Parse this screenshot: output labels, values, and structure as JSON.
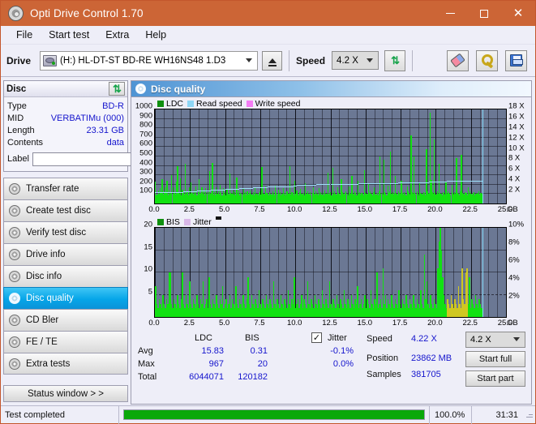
{
  "window": {
    "title": "Opti Drive Control 1.70",
    "icon": "disc-icon",
    "minimize": "—",
    "maximize": "□",
    "close": "✕"
  },
  "menu": {
    "items": [
      "File",
      "Start test",
      "Extra",
      "Help"
    ]
  },
  "toolbar": {
    "drive_label": "Drive",
    "drive_value": "(H:)   HL-DT-ST BD-RE  WH16NS48 1.D3",
    "eject_title": "eject-button",
    "speed_label": "Speed",
    "speed_value": "4.2 X",
    "refresh_icon": "refresh-icon",
    "erase_icon": "eraser-icon",
    "tools_icon": "wrench-icon",
    "save_icon": "floppy-save-icon"
  },
  "disc_panel": {
    "title": "Disc",
    "refresh_icon": "refresh-icon",
    "rows": [
      {
        "key": "Type",
        "value": "BD-R"
      },
      {
        "key": "MID",
        "value": "VERBATIMu (000)"
      },
      {
        "key": "Length",
        "value": "23.31 GB"
      },
      {
        "key": "Contents",
        "value": "data"
      }
    ],
    "label_key": "Label",
    "label_value": "",
    "label_placeholder": "",
    "disc_icon": "cd-disc-icon"
  },
  "nav": {
    "items": [
      {
        "label": "Transfer rate",
        "active": false
      },
      {
        "label": "Create test disc",
        "active": false
      },
      {
        "label": "Verify test disc",
        "active": false
      },
      {
        "label": "Drive info",
        "active": false
      },
      {
        "label": "Disc info",
        "active": false
      },
      {
        "label": "Disc quality",
        "active": true
      },
      {
        "label": "CD Bler",
        "active": false
      },
      {
        "label": "FE / TE",
        "active": false
      },
      {
        "label": "Extra tests",
        "active": false
      }
    ],
    "status_window": "Status window > >"
  },
  "content": {
    "header_title": "Disc quality",
    "header_icon": "disc-quality-icon"
  },
  "stats": {
    "col_ldc": "LDC",
    "col_bis": "BIS",
    "jitter_label": "Jitter",
    "jitter_checked": true,
    "rows": [
      {
        "name": "Avg",
        "ldc": "15.83",
        "bis": "0.31",
        "jitter": "-0.1%"
      },
      {
        "name": "Max",
        "ldc": "967",
        "bis": "20",
        "jitter": "0.0%"
      },
      {
        "name": "Total",
        "ldc": "6044071",
        "bis": "120182",
        "jitter": ""
      }
    ],
    "speed_label": "Speed",
    "speed_value": "4.22 X",
    "position_label": "Position",
    "position_value": "23862 MB",
    "samples_label": "Samples",
    "samples_value": "381705",
    "speed_select": "4.2 X",
    "start_full": "Start full",
    "start_part": "Start part"
  },
  "statusbar": {
    "text": "Test completed",
    "percent": "100.0%",
    "progress": 100,
    "time": "31:31"
  },
  "chart_data": [
    {
      "type": "bar",
      "name": "ldc-chart",
      "title": "LDC",
      "legend": [
        {
          "label": "LDC",
          "color": "#0f8f0f"
        },
        {
          "label": "Read speed",
          "color": "#8ed6f5"
        },
        {
          "label": "Write speed",
          "color": "#f47cf4"
        }
      ],
      "xlabel": "GB",
      "ylabel": "LDC",
      "xlim": [
        0,
        25
      ],
      "ylim": [
        0,
        1000
      ],
      "y2lim": [
        0,
        18
      ],
      "y2label": "X",
      "yticks": [
        100,
        200,
        300,
        400,
        500,
        600,
        700,
        800,
        900,
        1000
      ],
      "y2ticks": [
        2,
        4,
        6,
        8,
        10,
        12,
        14,
        16,
        18
      ],
      "xticks": [
        "0.0",
        "2.5",
        "5.0",
        "7.5",
        "10.0",
        "12.5",
        "15.0",
        "17.5",
        "20.0",
        "22.5",
        "25.0"
      ],
      "data_end_gb": 23.31,
      "bar_color": "#12e112",
      "speed_color": "#9fe0fb",
      "plot_bg": "#6b7894",
      "grid": true,
      "values": [
        230,
        85,
        95,
        140,
        105,
        160,
        120,
        260,
        95,
        130,
        175,
        110,
        240,
        90,
        150,
        105,
        125,
        305,
        100,
        170,
        115,
        95,
        230,
        400,
        120,
        100,
        265,
        90,
        150,
        110,
        95,
        420,
        105,
        130,
        90,
        170,
        100,
        220,
        115,
        95,
        140,
        100,
        185,
        90,
        120,
        255,
        95,
        110,
        170,
        100,
        135,
        90,
        160,
        105,
        120,
        95,
        345,
        100,
        110,
        430,
        95,
        120,
        90,
        170,
        100,
        130,
        95,
        200,
        110,
        90,
        160,
        100,
        125,
        90,
        150,
        105,
        95,
        320,
        110,
        100,
        140,
        95,
        120,
        90,
        280,
        105,
        135,
        90,
        110,
        100,
        95,
        160,
        105,
        120,
        90,
        130,
        95,
        110,
        140,
        100,
        95,
        120,
        90,
        160,
        105,
        100,
        90,
        110,
        130,
        95,
        385,
        105,
        100,
        95,
        185,
        110,
        100,
        90,
        120,
        105,
        95,
        130,
        100,
        90,
        190,
        110,
        95,
        150,
        105,
        120,
        90,
        100,
        165,
        95,
        110,
        90,
        130,
        105,
        100,
        400,
        95,
        120,
        110,
        90,
        245,
        100,
        135,
        105,
        90,
        120,
        155,
        100,
        95,
        110,
        90,
        215,
        105,
        130,
        100,
        95,
        120,
        90,
        110,
        175,
        100,
        95,
        130,
        105,
        90,
        160,
        100,
        120,
        95,
        110,
        90,
        140,
        105,
        100,
        330,
        95,
        110,
        120,
        90,
        380,
        100,
        130,
        105,
        95,
        170,
        110,
        100,
        90,
        260,
        120,
        105,
        95,
        110,
        130,
        100,
        90,
        180,
        115,
        105,
        290,
        100,
        95,
        130,
        110,
        90,
        240,
        105,
        120,
        95,
        110,
        100,
        90,
        355,
        115,
        105,
        95,
        205,
        110,
        130,
        100,
        90,
        120,
        175,
        105,
        95,
        110,
        90,
        130,
        500,
        105,
        115,
        95,
        465,
        120,
        105,
        90,
        190,
        110,
        130,
        555,
        100,
        120,
        95,
        110,
        290,
        105,
        90,
        130,
        115,
        100,
        245,
        110,
        95,
        120,
        105,
        90,
        180,
        130,
        110,
        95,
        720,
        120,
        105,
        500,
        110,
        95,
        130,
        100,
        90,
        215,
        115,
        105,
        95,
        120,
        110,
        90,
        580,
        130,
        105,
        115,
        965,
        250,
        120,
        105,
        680,
        110,
        95,
        130,
        100,
        420,
        115,
        105,
        90,
        120,
        110,
        95,
        230,
        105,
        130,
        115,
        100,
        90,
        200,
        110,
        95,
        120,
        105,
        480,
        115,
        100,
        90,
        130,
        520,
        110,
        105,
        95,
        120,
        110,
        90,
        170,
        105,
        130,
        100,
        95,
        110,
        120,
        90,
        105,
        115,
        100,
        130,
        95,
        110,
        105
      ]
    },
    {
      "type": "bar",
      "name": "bis-jitter-chart",
      "title": "BIS",
      "legend": [
        {
          "label": "BIS",
          "color": "#0f8f0f"
        },
        {
          "label": "Jitter",
          "color": "#d9b8e8"
        }
      ],
      "xlabel": "GB",
      "ylabel": "BIS",
      "xlim": [
        0,
        25
      ],
      "ylim": [
        0,
        20
      ],
      "y2lim": [
        0,
        10
      ],
      "y2label": "%",
      "yticks": [
        5,
        10,
        15,
        20
      ],
      "y2ticks": [
        "2%",
        "4%",
        "6%",
        "8%",
        "10%"
      ],
      "xticks": [
        "0.0",
        "2.5",
        "5.0",
        "7.5",
        "10.0",
        "12.5",
        "15.0",
        "17.5",
        "20.0",
        "22.5",
        "25.0"
      ],
      "data_end_gb": 23.31,
      "bar_color": "#12e112",
      "jitter_color": "#cfc721",
      "plot_bg": "#6b7894",
      "grid": true,
      "values": [
        7,
        3,
        2,
        4,
        3,
        2,
        5,
        3,
        2,
        4,
        3,
        10,
        10,
        3,
        2,
        4,
        3,
        2,
        5,
        3,
        2,
        4,
        10,
        3,
        2,
        5,
        3,
        2,
        8,
        3,
        2,
        4,
        3,
        2,
        5,
        3,
        2,
        4,
        3,
        8,
        2,
        3,
        4,
        2,
        9,
        3,
        2,
        4,
        3,
        2,
        5,
        3,
        2,
        4,
        3,
        7,
        2,
        3,
        4,
        2,
        3,
        5,
        2,
        4,
        3,
        2,
        7,
        3,
        2,
        4,
        3,
        2,
        5,
        3,
        2,
        4,
        9,
        3,
        2,
        5,
        3,
        2,
        4,
        3,
        2,
        6,
        3,
        2,
        4,
        3,
        2,
        5,
        3,
        2,
        4,
        3,
        2,
        8,
        3,
        2,
        4,
        3,
        2,
        5,
        3,
        2,
        4,
        3,
        2,
        6,
        3,
        2,
        4,
        3,
        9,
        2,
        3,
        4,
        2,
        3,
        5,
        2,
        4,
        3,
        2,
        8,
        3,
        2,
        4,
        3,
        2,
        5,
        3,
        2,
        4,
        3,
        2,
        6,
        3,
        2,
        4,
        3,
        2,
        8,
        3,
        2,
        4,
        3,
        2,
        5,
        3,
        2,
        4,
        3,
        2,
        6,
        3,
        2,
        4,
        3,
        2,
        5,
        3,
        2,
        4,
        3,
        7,
        2,
        3,
        4,
        2,
        3,
        5,
        2,
        4,
        3,
        2,
        6,
        3,
        2,
        4,
        3,
        10,
        2,
        3,
        4,
        2,
        11,
        3,
        5,
        2,
        4,
        3,
        2,
        5,
        3,
        2,
        4,
        3,
        2,
        6,
        3,
        2,
        4,
        3,
        2,
        5,
        3,
        2,
        4,
        3,
        2,
        5,
        3,
        2,
        4,
        3,
        2,
        6,
        3,
        2,
        14,
        4,
        8,
        3,
        2,
        5,
        3,
        2,
        4,
        3,
        2,
        11,
        17,
        20,
        15,
        9,
        5,
        3,
        2,
        4,
        3,
        2,
        5,
        3,
        2,
        4,
        3,
        2,
        7,
        3,
        2,
        11,
        4,
        3,
        10,
        11,
        3,
        9,
        2,
        4,
        3,
        2,
        5,
        3,
        2,
        4,
        3,
        2
      ]
    }
  ]
}
